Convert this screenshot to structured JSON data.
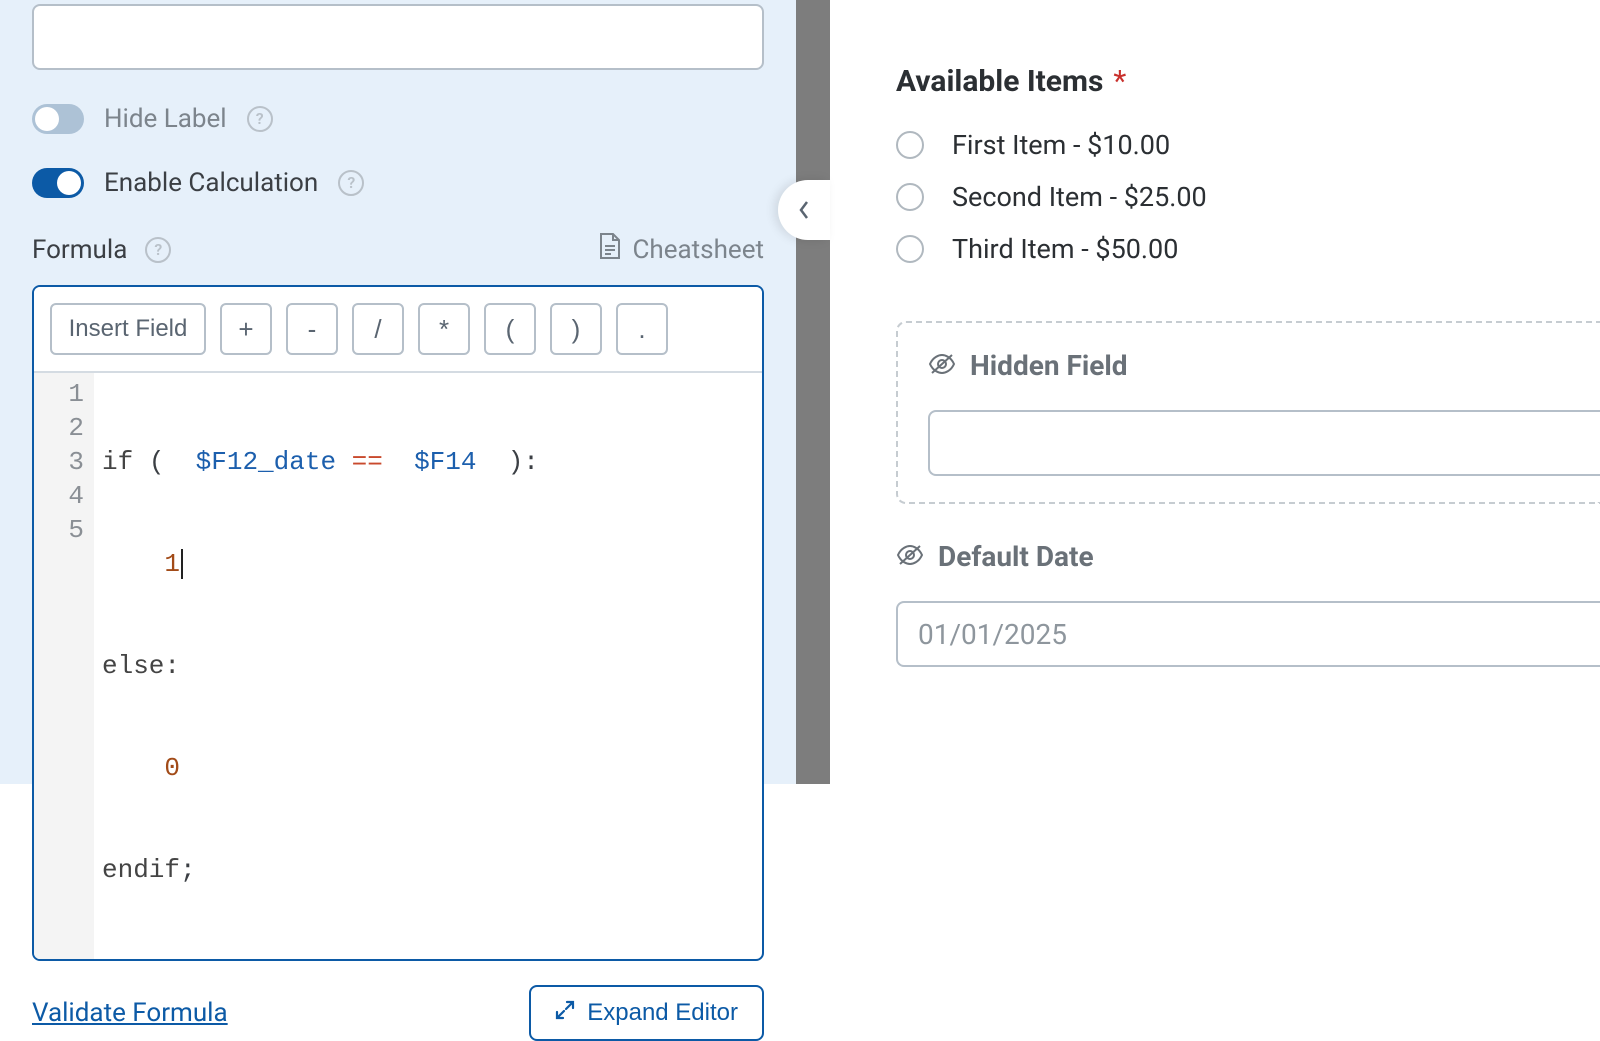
{
  "left": {
    "toggles": {
      "hideLabel": {
        "label": "Hide Label",
        "enabled": false
      },
      "enableCalc": {
        "label": "Enable Calculation",
        "enabled": true
      }
    },
    "formula": {
      "label": "Formula",
      "cheatsheet": "Cheatsheet"
    },
    "toolbar": {
      "insert": "Insert Field",
      "ops": [
        "+",
        "-",
        "/",
        "*",
        "(",
        ")",
        "."
      ]
    },
    "code": {
      "gutter": [
        "1",
        "2",
        "3",
        "4",
        "5"
      ],
      "line1": {
        "if": "if",
        "open": " ( ",
        "var1": " $F12_date",
        "eq": " ==",
        "var2": "  $F14",
        "close": "  ):"
      },
      "line2_indent": "    ",
      "line2_val": "1",
      "line3": "else:",
      "line4_indent": "    ",
      "line4_val": "0",
      "line5": "endif",
      "line5_semi": ";"
    },
    "validate": "Validate Formula",
    "expand": "Expand Editor"
  },
  "right": {
    "available": {
      "label": "Available Items",
      "required": "*",
      "options": [
        "First Item - $10.00",
        "Second Item - $25.00",
        "Third Item - $50.00"
      ]
    },
    "hiddenField": {
      "label": "Hidden Field",
      "value": ""
    },
    "defaultDate": {
      "label": "Default Date",
      "value": "01/01/2025"
    }
  }
}
